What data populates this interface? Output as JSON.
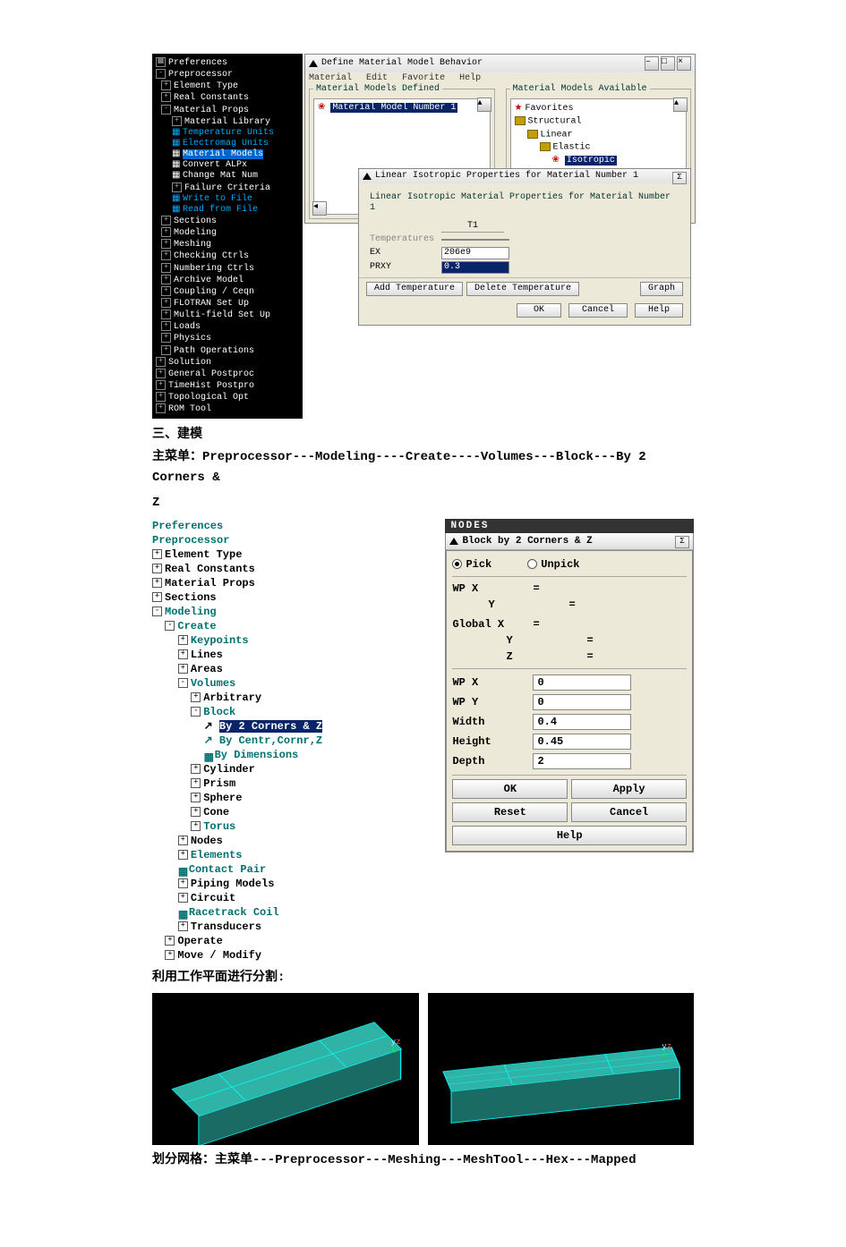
{
  "tree1": {
    "items": [
      "Preferences",
      "Preprocessor",
      "Element Type",
      "Real Constants",
      "Material Props",
      "Material Library",
      "Temperature Units",
      "Electromag Units",
      "Material Models",
      "Convert ALPx",
      "Change Mat Num",
      "Failure Criteria",
      "Write to File",
      "Read from File",
      "Sections",
      "Modeling",
      "Meshing",
      "Checking Ctrls",
      "Numbering Ctrls",
      "Archive Model",
      "Coupling / Ceqn",
      "FLOTRAN Set Up",
      "Multi-field Set Up",
      "Loads",
      "Physics",
      "Path Operations",
      "Solution",
      "General Postproc",
      "TimeHist Postpro",
      "Topological Opt",
      "ROM Tool"
    ]
  },
  "matWin": {
    "title": "Define Material Model Behavior",
    "menu": [
      "Material",
      "Edit",
      "Favorite",
      "Help"
    ],
    "leftTitle": "Material Models Defined",
    "leftItem": "Material Model Number 1",
    "rightTitle": "Material Models Available",
    "rightItems": [
      "Favorites",
      "Structural",
      "Linear",
      "Elastic",
      "Isotropic"
    ]
  },
  "propWin": {
    "title": "Linear Isotropic Properties for Material Number 1",
    "heading": "Linear Isotropic Material Properties for Material Number 1",
    "col": "T1",
    "rows": {
      "temp": "Temperatures",
      "ex": "EX",
      "prxy": "PRXY"
    },
    "vals": {
      "temp": "",
      "ex": "206e9",
      "prxy": "0.3"
    },
    "btns": {
      "addT": "Add Temperature",
      "delT": "Delete Temperature",
      "graph": "Graph",
      "ok": "OK",
      "cancel": "Cancel",
      "help": "Help"
    },
    "closeX": "Σ"
  },
  "text": {
    "section3": "三、建模",
    "mainMenuLine": "主菜单：Preprocessor---Modeling----Create----Volumes---Block---By 2  Corners &",
    "z": "Z",
    "splitLine": "利用工作平面进行分割:",
    "meshLine": "划分网格：主菜单---Preprocessor---Meshing---MeshTool---Hex---Mapped"
  },
  "tree2": {
    "items": [
      "Preferences",
      "Preprocessor",
      "Element Type",
      "Real Constants",
      "Material Props",
      "Sections",
      "Modeling",
      "Create",
      "Keypoints",
      "Lines",
      "Areas",
      "Volumes",
      "Arbitrary",
      "Block",
      "By 2 Corners & Z",
      "By Centr,Cornr,Z",
      "By Dimensions",
      "Cylinder",
      "Prism",
      "Sphere",
      "Cone",
      "Torus",
      "Nodes",
      "Elements",
      "Contact Pair",
      "Piping Models",
      "Circuit",
      "Racetrack Coil",
      "Transducers",
      "Operate",
      "Move / Modify"
    ]
  },
  "dialog2": {
    "nodes": "NODES",
    "title": "Block by 2 Corners & Z",
    "pick": "Pick",
    "unpick": "Unpick",
    "labels": {
      "wpx0": "WP X",
      "y0": "Y",
      "gx": "Global X",
      "gy": "Y",
      "gz": "Z",
      "wpx": "WP X",
      "wpy": "WP Y",
      "width": "Width",
      "height": "Height",
      "depth": "Depth"
    },
    "eq": "=",
    "dash": "=",
    "vals": {
      "wpx": "0",
      "wpy": "0",
      "width": "0.4",
      "height": "0.45",
      "depth": "2"
    },
    "btns": {
      "ok": "OK",
      "apply": "Apply",
      "reset": "Reset",
      "cancel": "Cancel",
      "help": "Help"
    },
    "closeX": "Σ"
  }
}
